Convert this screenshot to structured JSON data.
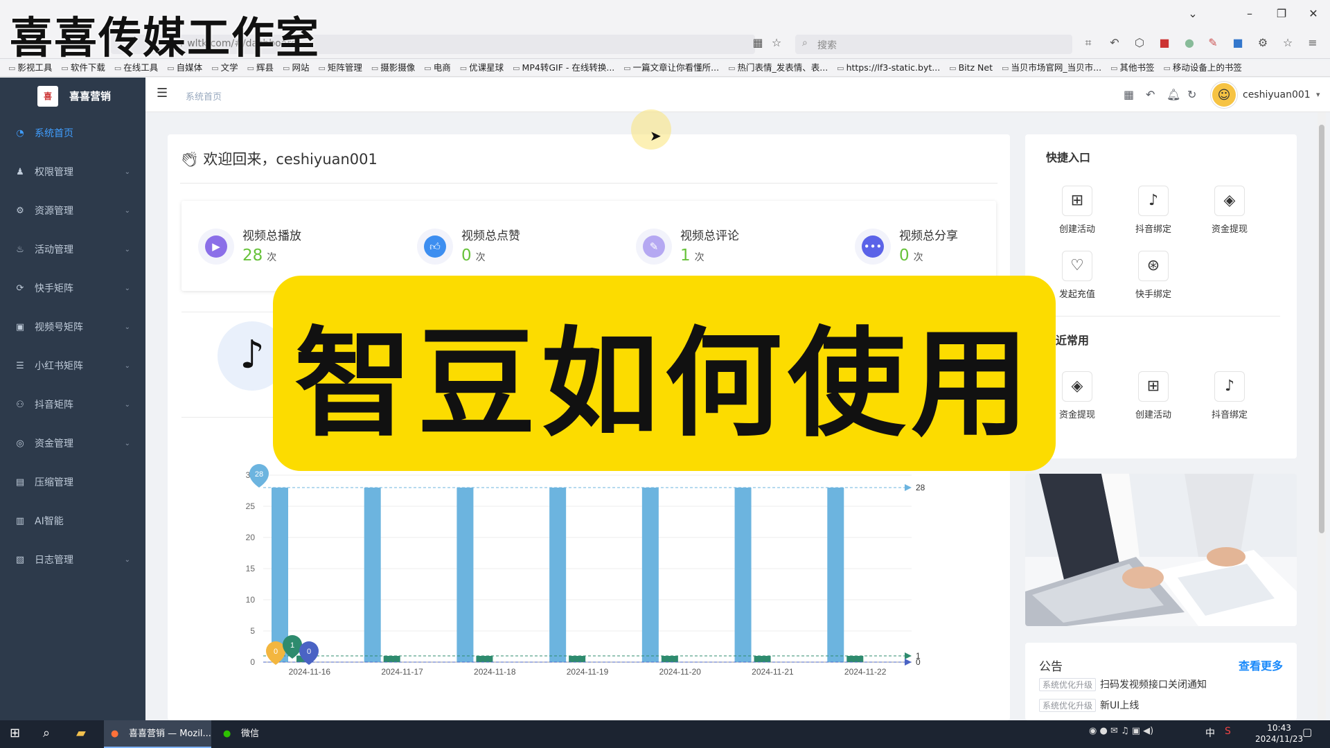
{
  "watermark": "喜喜传媒工作室",
  "browser": {
    "address_text": "r wltk.com/#/dashboard",
    "search_placeholder": "搜索",
    "bookmarks": [
      "影视工具",
      "软件下载",
      "在线工具",
      "自媒体",
      "文学",
      "辉县",
      "网站",
      "矩阵管理",
      "摄影摄像",
      "电商",
      "优课星球",
      "MP4转GIF - 在线转换...",
      "一篇文章让你看懂所...",
      "热门表情_发表情、表...",
      "https://lf3-static.byt...",
      "Bitz Net",
      "当贝市场官网_当贝市...",
      "其他书签",
      "移动设备上的书签"
    ]
  },
  "sidebar": {
    "brand": "喜喜营销",
    "logo_text": "喜",
    "items": [
      {
        "label": "系统首页",
        "icon": "dashboard-icon",
        "active": true
      },
      {
        "label": "权限管理",
        "icon": "user-icon"
      },
      {
        "label": "资源管理",
        "icon": "gear-icon"
      },
      {
        "label": "活动管理",
        "icon": "flame-icon"
      },
      {
        "label": "快手矩阵",
        "icon": "shuffle-icon"
      },
      {
        "label": "视频号矩阵",
        "icon": "video-icon"
      },
      {
        "label": "小红书矩阵",
        "icon": "list-icon"
      },
      {
        "label": "抖音矩阵",
        "icon": "people-icon"
      },
      {
        "label": "资金管理",
        "icon": "money-icon"
      },
      {
        "label": "压缩管理",
        "icon": "file-icon"
      },
      {
        "label": "AI智能",
        "icon": "ai-icon"
      },
      {
        "label": "日志管理",
        "icon": "log-icon"
      }
    ]
  },
  "header": {
    "breadcrumb": "系统首页",
    "username": "ceshiyuan001"
  },
  "welcome": "欢迎回来，ceshiyuan001",
  "stats": [
    {
      "label": "视频总播放",
      "value": "28",
      "unit": "次",
      "color": "#8b6fe8"
    },
    {
      "label": "视频总点赞",
      "value": "0",
      "unit": "次",
      "color": "#3d8ef0"
    },
    {
      "label": "视频总评论",
      "value": "1",
      "unit": "次",
      "color": "#b5a8f2"
    },
    {
      "label": "视频总分享",
      "value": "0",
      "unit": "次",
      "color": "#5b63e8"
    }
  ],
  "banner": "智豆如何使用",
  "quick_entry": {
    "title": "快捷入口",
    "items": [
      {
        "label": "创建活动",
        "icon": "create-activity-icon",
        "glyph": "⊞"
      },
      {
        "label": "抖音绑定",
        "icon": "tiktok-bind-icon",
        "glyph": "♪"
      },
      {
        "label": "资金提现",
        "icon": "withdraw-icon",
        "glyph": "◈"
      },
      {
        "label": "发起充值",
        "icon": "recharge-icon",
        "glyph": "♡"
      },
      {
        "label": "快手绑定",
        "icon": "kuaishou-bind-icon",
        "glyph": "⊛"
      }
    ],
    "recent_title": "近常用",
    "recent": [
      {
        "label": "资金提现",
        "icon": "withdraw-icon",
        "glyph": "◈"
      },
      {
        "label": "创建活动",
        "icon": "create-activity-icon",
        "glyph": "⊞"
      },
      {
        "label": "抖音绑定",
        "icon": "tiktok-bind-icon",
        "glyph": "♪"
      }
    ]
  },
  "notice": {
    "title": "公告",
    "more": "查看更多",
    "rows": [
      {
        "tag": "系统优化升级",
        "text": "扫码发视频接口关闭通知"
      },
      {
        "tag": "系统优化升级",
        "text": "新UI上线"
      }
    ]
  },
  "chart_data": {
    "type": "bar",
    "categories": [
      "2024-11-16",
      "2024-11-17",
      "2024-11-18",
      "2024-11-19",
      "2024-11-20",
      "2024-11-21",
      "2024-11-22"
    ],
    "ylim": [
      0,
      30
    ],
    "yticks": [
      0,
      5,
      10,
      15,
      20,
      25,
      30
    ],
    "series": [
      {
        "values": [
          28,
          28,
          28,
          28,
          28,
          28,
          28
        ],
        "color": "#6cb4df"
      },
      {
        "values": [
          1,
          1,
          1,
          1,
          1,
          1,
          1
        ],
        "color": "#2e8b6e"
      }
    ],
    "markers": [
      {
        "label": "28",
        "value": 28,
        "color": "#6cb4df"
      },
      {
        "label": "0",
        "value": 0,
        "color": "#f3b63f"
      },
      {
        "label": "1",
        "value": 1,
        "color": "#2e8b6e"
      },
      {
        "label": "0",
        "value": 0,
        "color": "#4a63c4"
      }
    ],
    "avg_labels": [
      "28",
      "1",
      "0"
    ]
  },
  "taskbar": {
    "tasks": [
      {
        "label": "喜喜营销 — Mozil...",
        "active": true
      },
      {
        "label": "微信",
        "active": false
      }
    ],
    "time": "10:43",
    "date": "2024/11/23",
    "ime": "中"
  }
}
